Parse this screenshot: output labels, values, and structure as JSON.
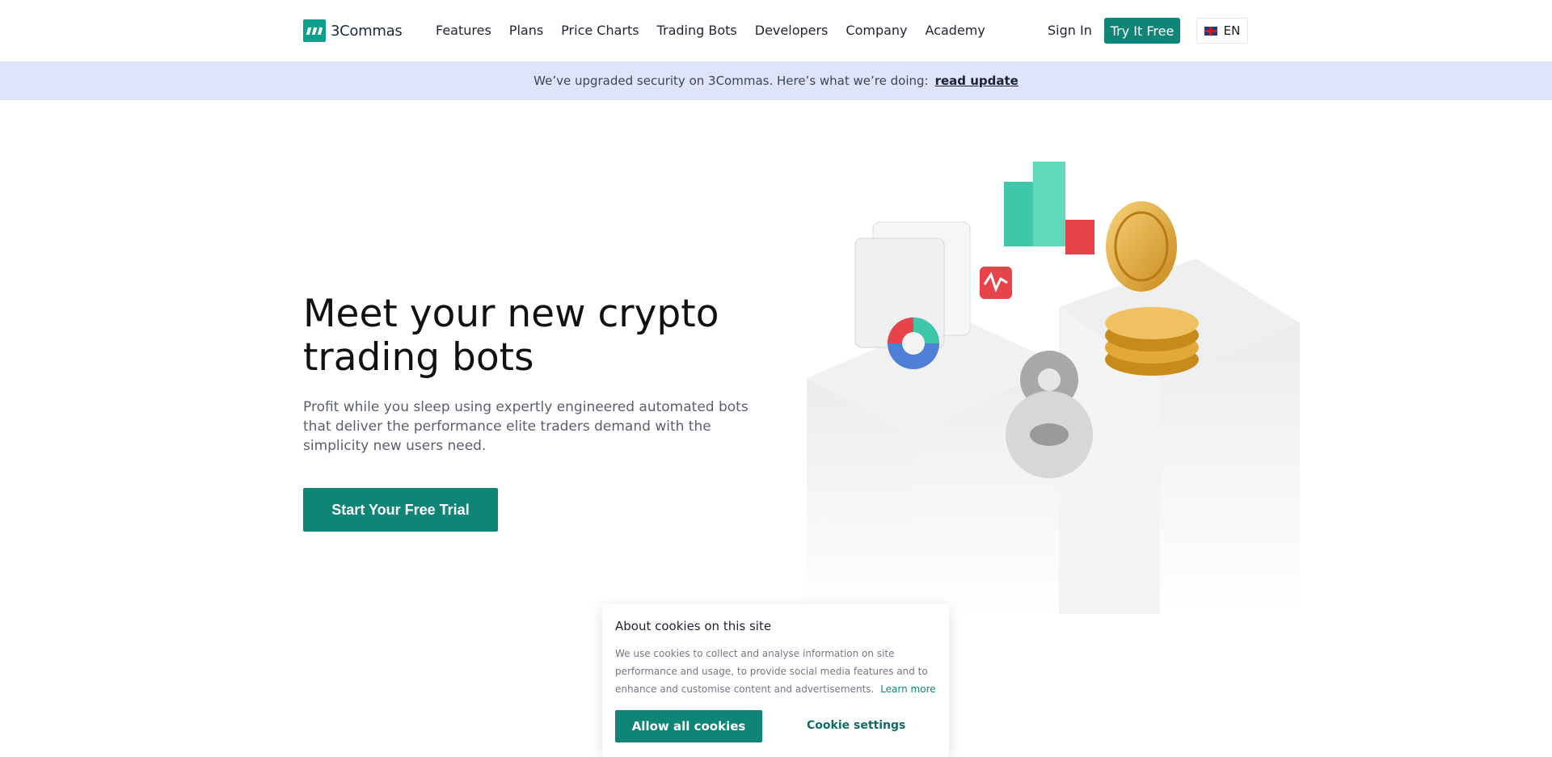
{
  "header": {
    "logo_text": "3Commas",
    "nav": [
      "Features",
      "Plans",
      "Price Charts",
      "Trading Bots",
      "Developers",
      "Company",
      "Academy"
    ],
    "sign_in": "Sign In",
    "try_free": "Try It Free",
    "language": "EN"
  },
  "banner": {
    "text": "We’ve upgraded security on 3Commas. Here’s what we’re doing:",
    "link": "read update"
  },
  "hero": {
    "title_line1": "Meet your new crypto",
    "title_line2": "trading bots",
    "subtitle": "Profit while you sleep using expertly engineered automated bots that deliver the performance elite traders demand with the simplicity new users need.",
    "cta": "Start Your Free Trial"
  },
  "cookie": {
    "title": "About cookies on this site",
    "text": "We use cookies to collect and analyse information on site performance and usage, to provide social media features and to enhance and customise content and advertisements.",
    "learn_more": "Learn more",
    "allow": "Allow all cookies",
    "settings": "Cookie settings"
  },
  "colors": {
    "brand": "#0f8577",
    "banner_bg": "#dfe4fd"
  }
}
